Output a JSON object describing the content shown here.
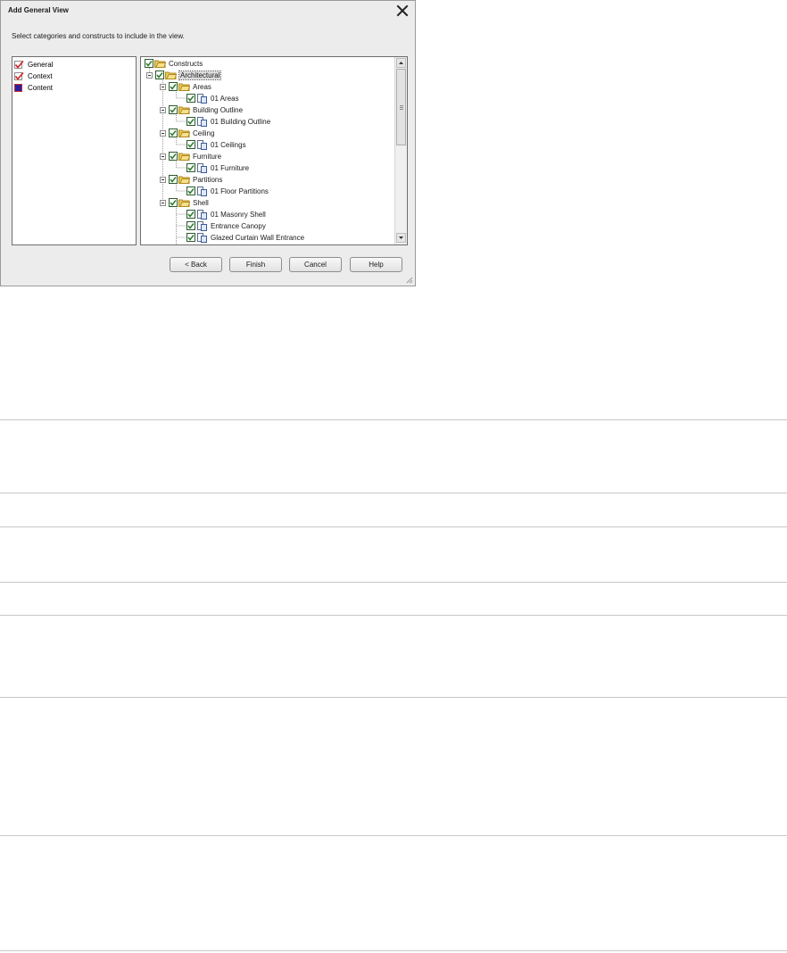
{
  "dialog": {
    "title": "Add General View",
    "instructions": "Select categories and constructs to include in the view.",
    "close_icon": "close-icon"
  },
  "categories": [
    {
      "label": "General",
      "icon": "checked-icon",
      "color": "#d02020"
    },
    {
      "label": "Context",
      "icon": "checked-icon",
      "color": "#d02020"
    },
    {
      "label": "Content",
      "icon": "filled-square-icon",
      "color": "#2a1fa0"
    }
  ],
  "tree": [
    {
      "label": "Constructs",
      "level": 0,
      "expandable": false,
      "icon": "folder-icon",
      "checked": true
    },
    {
      "label": "Architectural",
      "level": 1,
      "expandable": true,
      "icon": "folder-icon",
      "checked": true,
      "selected": true
    },
    {
      "label": "Areas",
      "level": 2,
      "expandable": true,
      "icon": "folder-icon",
      "checked": true
    },
    {
      "label": "01 Areas",
      "level": 3,
      "expandable": false,
      "icon": "construct-icon",
      "checked": true
    },
    {
      "label": "Building Outline",
      "level": 2,
      "expandable": true,
      "icon": "folder-icon",
      "checked": true
    },
    {
      "label": "01 Building Outline",
      "level": 3,
      "expandable": false,
      "icon": "construct-icon",
      "checked": true
    },
    {
      "label": "Ceiling",
      "level": 2,
      "expandable": true,
      "icon": "folder-icon",
      "checked": true
    },
    {
      "label": "01 Ceilings",
      "level": 3,
      "expandable": false,
      "icon": "construct-icon",
      "checked": true
    },
    {
      "label": "Furniture",
      "level": 2,
      "expandable": true,
      "icon": "folder-icon",
      "checked": true
    },
    {
      "label": "01 Furniture",
      "level": 3,
      "expandable": false,
      "icon": "construct-icon",
      "checked": true
    },
    {
      "label": "Partitions",
      "level": 2,
      "expandable": true,
      "icon": "folder-icon",
      "checked": true
    },
    {
      "label": "01 Floor Partitions",
      "level": 3,
      "expandable": false,
      "icon": "construct-icon",
      "checked": true
    },
    {
      "label": "Shell",
      "level": 2,
      "expandable": true,
      "icon": "folder-icon",
      "checked": true
    },
    {
      "label": "01 Masonry Shell",
      "level": 3,
      "expandable": false,
      "icon": "construct-icon",
      "checked": true
    },
    {
      "label": "Entrance Canopy",
      "level": 3,
      "expandable": false,
      "icon": "construct-icon",
      "checked": true
    },
    {
      "label": "Glazed Curtain Wall Entrance",
      "level": 3,
      "expandable": false,
      "icon": "construct-icon",
      "checked": true
    }
  ],
  "buttons": {
    "back": "< Back",
    "finish": "Finish",
    "cancel": "Cancel",
    "help": "Help"
  },
  "colors": {
    "checkmark": "#2a7a2a",
    "folder": "#e8c95a",
    "selection": "#dcdcdc"
  }
}
